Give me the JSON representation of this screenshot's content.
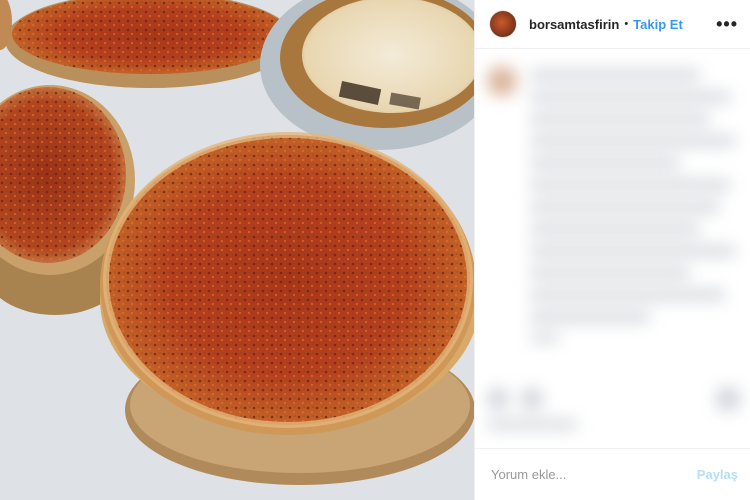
{
  "post": {
    "username": "borsamtasfirin",
    "separator": "•",
    "follow_label": "Takip Et",
    "more_icon": "•••",
    "image_subject": "lahmacun-photo"
  },
  "comment_box": {
    "placeholder": "Yorum ekle...",
    "post_label": "Paylaş"
  },
  "colors": {
    "follow": "#3897f0",
    "post_disabled": "#b2dffc",
    "text": "#262626"
  }
}
